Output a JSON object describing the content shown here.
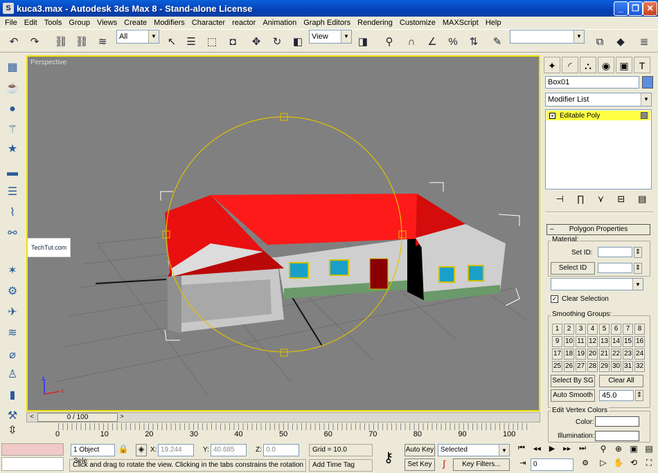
{
  "window": {
    "title": "kuca3.max - Autodesk 3ds Max 8 - Stand-alone License",
    "app_icon": "3ds-max-icon"
  },
  "menu": [
    "File",
    "Edit",
    "Tools",
    "Group",
    "Views",
    "Create",
    "Modifiers",
    "Character",
    "reactor",
    "Animation",
    "Graph Editors",
    "Rendering",
    "Customize",
    "MAXScript",
    "Help"
  ],
  "toolbar": {
    "selection_filter": "All",
    "reference_coord": "View",
    "named_selection": ""
  },
  "viewport": {
    "label": "Perspective",
    "watermark": "TechTut.com",
    "axis_z": "z",
    "axis_x": "x"
  },
  "command_panel": {
    "object_name": "Box01",
    "object_color": "#5b8ee0",
    "modifier_list": "Modifier List",
    "stack_item": "Editable Poly",
    "rollout_title": "Polygon Properties",
    "material_label": "Material:",
    "set_id_label": "Set ID:",
    "select_id_button": "Select ID",
    "clear_selection_label": "Clear Selection",
    "clear_selection_checked": true,
    "smoothing_label": "Smoothing Groups:",
    "smoothing_numbers": [
      "1",
      "2",
      "3",
      "4",
      "5",
      "6",
      "7",
      "8",
      "9",
      "10",
      "11",
      "12",
      "13",
      "14",
      "15",
      "16",
      "17",
      "18",
      "19",
      "20",
      "21",
      "22",
      "23",
      "24",
      "25",
      "26",
      "27",
      "28",
      "29",
      "30",
      "31",
      "32"
    ],
    "select_by_sg": "Select By SG",
    "clear_all": "Clear All",
    "auto_smooth": "Auto Smooth",
    "auto_smooth_value": "45.0",
    "edit_vertex_colors": "Edit Vertex Colors",
    "color_label": "Color:",
    "illumination_label": "Illumination:"
  },
  "timeline": {
    "frame": "0 / 100",
    "ticks": [
      "0",
      "10",
      "20",
      "30",
      "40",
      "50",
      "60",
      "70",
      "80",
      "90",
      "100"
    ]
  },
  "status": {
    "selection": "1 Object Sele",
    "x_label": "X:",
    "x": "19.244",
    "y_label": "Y:",
    "y": "40.685",
    "z_label": "Z:",
    "z": "0.0",
    "grid": "Grid = 10.0",
    "auto_key": "Auto Key",
    "key_mode": "Selected",
    "set_key": "Set Key",
    "key_filters": "Key Filters...",
    "frame": "0",
    "prompt": "Click and drag to rotate the view.  Clicking in the tabs constrains the rotation",
    "add_time_tag": "Add Time Tag"
  },
  "colors": {
    "roof": "#e81010",
    "walls": "#c8c8c8",
    "viewport_bg": "#808080",
    "active_border": "#f0e000",
    "gizmo": "#e0c000"
  }
}
